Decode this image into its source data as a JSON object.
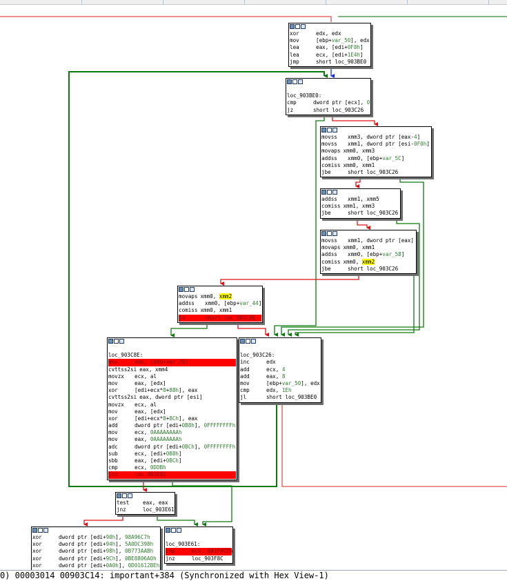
{
  "status_bar": {
    "text": "0) 00003014 00903C14: important+384 (Synchronized with Hex View-1)"
  },
  "nodes": {
    "n1": {
      "lines": [
        {
          "m": "xor",
          "o": "edx, edx"
        },
        {
          "m": "mov",
          "o": "[ebp+var_50], edx"
        },
        {
          "m": "lea",
          "o": "eax, [edi+0F8h]"
        },
        {
          "m": "lea",
          "o": "ecx, [edi+1E4h]"
        },
        {
          "m": "jmp",
          "o": "short loc_903BE0"
        }
      ]
    },
    "n2": {
      "label": "loc_903BE0:",
      "lines": [
        {
          "m": "cmp",
          "o": "dword ptr [ecx], 0"
        },
        {
          "m": "jz",
          "o": "short loc_903C26"
        }
      ]
    },
    "n3": {
      "lines": [
        {
          "m": "movss",
          "o": "xmm3, dword ptr [eax-4]"
        },
        {
          "m": "movss",
          "o": "xmm1, dword ptr [esi-0F0h]"
        },
        {
          "m": "movaps",
          "o": "xmm0, xmm3"
        },
        {
          "m": "addss",
          "o": "xmm0, [ebp+var_5C]"
        },
        {
          "m": "comiss",
          "o": "xmm0, xmm1"
        },
        {
          "m": "jbe",
          "o": "short loc_903C26"
        }
      ]
    },
    "n4": {
      "lines": [
        {
          "m": "addss",
          "o": "xmm1, xmm5"
        },
        {
          "m": "comiss",
          "o": "xmm1, xmm3"
        },
        {
          "m": "jbe",
          "o": "short loc_903C26"
        }
      ]
    },
    "n5": {
      "lines": [
        {
          "m": "movss",
          "o": "xmm1, dword ptr [eax]"
        },
        {
          "m": "movaps",
          "o": "xmm0, xmm1"
        },
        {
          "m": "addss",
          "o": "xmm0, [ebp+var_58]"
        },
        {
          "m": "comiss",
          "o": "xmm0, xmm2"
        },
        {
          "m": "jbe",
          "o": "short loc_903C26"
        }
      ]
    },
    "n6": {
      "lines": [
        {
          "m": "movaps",
          "o": "xmm0, xmm2"
        },
        {
          "m": "addss",
          "o": "xmm0, [ebp+var_44]"
        },
        {
          "m": "comiss",
          "o": "xmm0, xmm1"
        },
        {
          "m": "jb",
          "o": "short loc_903C8E"
        }
      ]
    },
    "n7": {
      "label": "loc_903C8E:",
      "lines": [
        {
          "m": "mov",
          "o": "edx, [ebp+var_70]"
        },
        {
          "m": "cvttss2si",
          "o": "eax, xmm4"
        },
        {
          "m": "movzx",
          "o": "ecx, al"
        },
        {
          "m": "mov",
          "o": "eax, [edx]"
        },
        {
          "m": "xor",
          "o": "[edi+ecx*8+88h], eax"
        },
        {
          "m": "cvttss2si",
          "o": "eax, dword ptr [esi]"
        },
        {
          "m": "movzx",
          "o": "ecx, al"
        },
        {
          "m": "mov",
          "o": "eax, [edx]"
        },
        {
          "m": "xor",
          "o": "[edi+ecx*8+8Ch], eax"
        },
        {
          "m": "add",
          "o": "dword ptr [edi+0B8h], 0FFFFFFFFh"
        },
        {
          "m": "mov",
          "o": "ecx, 0AAAAAAAAh"
        },
        {
          "m": "mov",
          "o": "eax, 0AAAAAAAAh"
        },
        {
          "m": "adc",
          "o": "dword ptr [edi+0BCh], 0FFFFFFFFh"
        },
        {
          "m": "sub",
          "o": "ecx, [edi+0B8h]"
        },
        {
          "m": "sbb",
          "o": "eax, [edi+0BCh]"
        },
        {
          "m": "cmp",
          "o": "ecx, 0DDBh"
        },
        {
          "m": "jnz",
          "o": "loc_903E61"
        }
      ]
    },
    "n8": {
      "label": "loc_903C26:",
      "lines": [
        {
          "m": "inc",
          "o": "edx"
        },
        {
          "m": "add",
          "o": "ecx, 4"
        },
        {
          "m": "add",
          "o": "eax, 8"
        },
        {
          "m": "mov",
          "o": "[ebp+var_50], edx"
        },
        {
          "m": "cmp",
          "o": "edx, 1Eh"
        },
        {
          "m": "jl",
          "o": "short loc_903BE0"
        }
      ]
    },
    "n9": {
      "lines": [
        {
          "m": "test",
          "o": "eax, eax"
        },
        {
          "m": "jnz",
          "o": "loc_903E61"
        }
      ]
    },
    "n10": {
      "lines": [
        {
          "m": "xor",
          "o": "dword ptr [edi+90h], 98A96C7h"
        },
        {
          "m": "xor",
          "o": "dword ptr [edi+94h], 5A0DC398h"
        },
        {
          "m": "xor",
          "o": "dword ptr [edi+98h], 0B773AABh"
        },
        {
          "m": "xor",
          "o": "dword ptr [edi+9Ch], 0BE8806A0h"
        },
        {
          "m": "xor",
          "o": "dword ptr [edi+0A0h], 0D01612BEh"
        }
      ]
    },
    "n11": {
      "label": "loc_903E61:",
      "lines": [
        {
          "m": "cmp",
          "o": "ecx, 0A1F0CDh"
        },
        {
          "m": "jnz",
          "o": "loc_903F8C"
        }
      ]
    }
  }
}
